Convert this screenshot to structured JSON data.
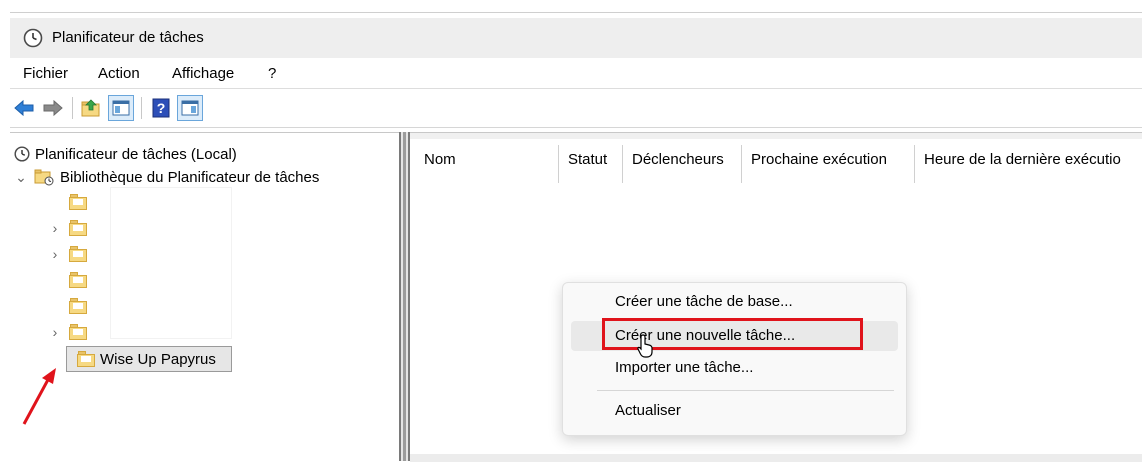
{
  "window": {
    "title": "Planificateur de tâches",
    "icon": "clock-icon"
  },
  "menubar": {
    "items": [
      "Fichier",
      "Action",
      "Affichage",
      "?"
    ]
  },
  "toolbar": {
    "buttons": [
      "back-arrow-icon",
      "forward-arrow-icon",
      "folder-up-icon",
      "show-hide-console-tree-icon",
      "help-icon",
      "show-hide-action-pane-icon"
    ]
  },
  "tree": {
    "root_label": "Planificateur de tâches (Local)",
    "library_label": "Bibliothèque du Planificateur de tâches",
    "selected_folder_label": "Wise Up Papyrus"
  },
  "table": {
    "columns": [
      "Nom",
      "Statut",
      "Déclencheurs",
      "Prochaine exécution",
      "Heure de la dernière exécutio"
    ]
  },
  "context_menu": {
    "items": [
      "Créer une tâche de base...",
      "Créer une nouvelle tâche...",
      "Importer une tâche...",
      "Actualiser"
    ],
    "highlighted_index": 1
  },
  "colors": {
    "annotation_red": "#e0131b",
    "folder_yellow": "#f6d983",
    "accent_blue": "#2f7fd6"
  }
}
